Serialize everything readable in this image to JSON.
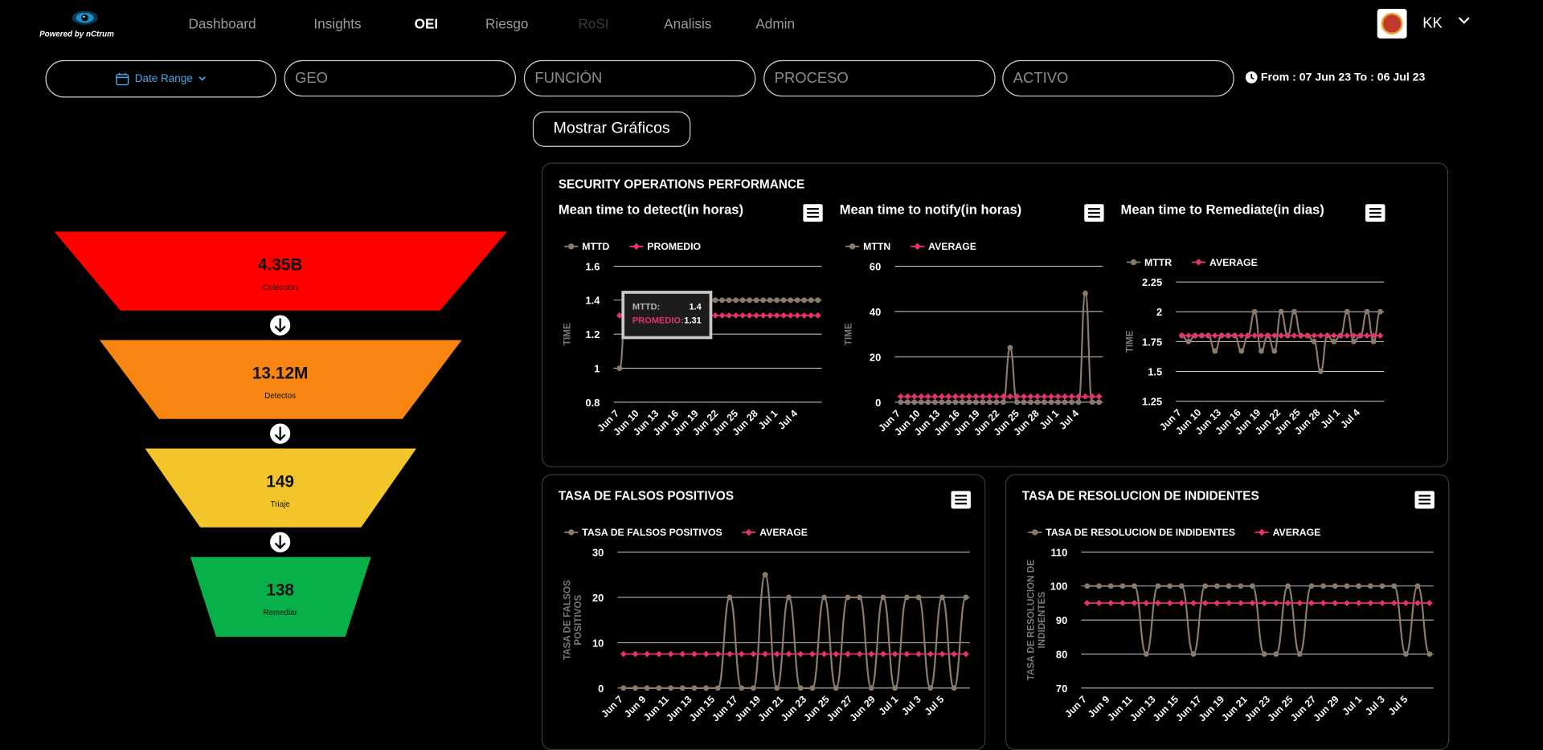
{
  "branding": {
    "powered_by": "Powered by  nCtrum"
  },
  "nav": {
    "items": [
      {
        "label": "Dashboard",
        "state": "normal"
      },
      {
        "label": "Insights",
        "state": "normal"
      },
      {
        "label": "OEI",
        "state": "active"
      },
      {
        "label": "Riesgo",
        "state": "normal"
      },
      {
        "label": "RoSI",
        "state": "disabled"
      },
      {
        "label": "Analisis",
        "state": "normal"
      },
      {
        "label": "Admin",
        "state": "normal"
      }
    ]
  },
  "user": {
    "initials": "KK"
  },
  "filters": {
    "date_range_label": "Date Range",
    "geo_placeholder": "GEO",
    "funcion_placeholder": "FUNCIÓN",
    "proceso_placeholder": "PROCESO",
    "activo_placeholder": "ACTIVO",
    "from_to": "From : 07 Jun 23 To : 06 Jul 23"
  },
  "mostrar_graficos": "Mostrar Gráficos",
  "funnel": [
    {
      "value": "4.35B",
      "label": "Coleccion",
      "color": "#fe0000"
    },
    {
      "value": "13.12M",
      "label": "Detectos",
      "color": "#f78511"
    },
    {
      "value": "149",
      "label": "Triaje",
      "color": "#f2c62a"
    },
    {
      "value": "138",
      "label": "Remediar",
      "color": "#09b04a"
    }
  ],
  "panels": {
    "sec_ops_title": "SECURITY OPERATIONS PERFORMANCE",
    "falsos_title": "TASA DE FALSOS POSITIVOS",
    "resolucion_title": "TASA DE RESOLUCION DE INDIDENTES"
  },
  "colors": {
    "series": "#8a7a6b",
    "average": "#e5336a"
  },
  "chart_data": [
    {
      "type": "line",
      "title": "Mean time to detect(in horas)",
      "ylabel": "TIME",
      "ylim": [
        0.8,
        1.6
      ],
      "yticks": [
        "0.8",
        "1",
        "1.2",
        "1.4",
        "1.6"
      ],
      "tick_values": [
        0.8,
        1,
        1.2,
        1.4,
        1.6
      ],
      "x_labels": [
        "Jun 7",
        "Jun 10",
        "Jun 13",
        "Jun 16",
        "Jun 19",
        "Jun 22",
        "Jun 25",
        "Jun 28",
        "Jul 1",
        "Jul 4"
      ],
      "series": [
        {
          "name": "MTTD",
          "values": [
            1.0,
            1.4,
            1.4,
            1.4,
            1.4,
            1.4,
            1.4,
            1.4,
            1.4,
            1.4,
            1.4,
            1.4,
            1.4,
            1.4,
            1.4,
            1.4,
            1.4,
            1.4,
            1.4,
            1.4,
            1.4,
            1.4,
            1.4,
            1.4,
            1.4,
            1.4,
            1.4,
            1.4,
            1.4,
            1.4
          ]
        },
        {
          "name": "PROMEDIO",
          "values": [
            1.31,
            1.31,
            1.31,
            1.31,
            1.31,
            1.31,
            1.31,
            1.31,
            1.31,
            1.31,
            1.31,
            1.31,
            1.31,
            1.31,
            1.31,
            1.31,
            1.31,
            1.31,
            1.31,
            1.31,
            1.31,
            1.31,
            1.31,
            1.31,
            1.31,
            1.31,
            1.31,
            1.31,
            1.31,
            1.31
          ]
        }
      ],
      "tooltip": {
        "label1": "MTTD:",
        "value1": "1.4",
        "label2": "PROMEDIO:",
        "value2": "1.31"
      }
    },
    {
      "type": "line",
      "title": "Mean time to notify(in horas)",
      "ylabel": "TIME",
      "ylim": [
        0,
        60
      ],
      "yticks": [
        "0",
        "20",
        "40",
        "60"
      ],
      "tick_values": [
        0,
        20,
        40,
        60
      ],
      "x_labels": [
        "Jun 7",
        "Jun 10",
        "Jun 13",
        "Jun 16",
        "Jun 19",
        "Jun 22",
        "Jun 25",
        "Jun 28",
        "Jul 1",
        "Jul 4"
      ],
      "series": [
        {
          "name": "MTTN",
          "values": [
            0,
            0,
            0,
            0,
            0,
            0,
            0,
            0,
            0,
            0,
            0,
            0,
            0,
            0,
            0,
            0,
            24,
            0,
            0,
            0,
            0,
            0,
            0,
            0,
            0,
            0,
            0,
            48,
            0,
            0
          ]
        },
        {
          "name": "AVERAGE",
          "values": [
            2.5,
            2.5,
            2.5,
            2.5,
            2.5,
            2.5,
            2.5,
            2.5,
            2.5,
            2.5,
            2.5,
            2.5,
            2.5,
            2.5,
            2.5,
            2.5,
            2.5,
            2.5,
            2.5,
            2.5,
            2.5,
            2.5,
            2.5,
            2.5,
            2.5,
            2.5,
            2.5,
            2.5,
            2.5,
            2.5
          ]
        }
      ]
    },
    {
      "type": "line",
      "title": "Mean time to Remediate(in dias)",
      "ylabel": "TIME",
      "ylim": [
        1.25,
        2.25
      ],
      "yticks": [
        "1.25",
        "1.5",
        "1.75",
        "2",
        "2.25"
      ],
      "tick_values": [
        1.25,
        1.5,
        1.75,
        2,
        2.25
      ],
      "x_labels": [
        "Jun 7",
        "Jun 10",
        "Jun 13",
        "Jun 16",
        "Jun 19",
        "Jun 22",
        "Jun 25",
        "Jun 28",
        "Jul 1",
        "Jul 4"
      ],
      "series": [
        {
          "name": "MTTR",
          "values": [
            1.8,
            1.75,
            1.8,
            1.8,
            1.8,
            1.67,
            1.8,
            1.8,
            1.8,
            1.67,
            1.8,
            2.0,
            1.67,
            1.8,
            1.67,
            2.0,
            1.8,
            2.0,
            1.8,
            1.8,
            1.75,
            1.5,
            1.8,
            1.75,
            1.8,
            2.0,
            1.75,
            1.8,
            2.0,
            1.75,
            2.0
          ]
        },
        {
          "name": "AVERAGE",
          "values": [
            1.8,
            1.8,
            1.8,
            1.8,
            1.8,
            1.8,
            1.8,
            1.8,
            1.8,
            1.8,
            1.8,
            1.8,
            1.8,
            1.8,
            1.8,
            1.8,
            1.8,
            1.8,
            1.8,
            1.8,
            1.8,
            1.8,
            1.8,
            1.8,
            1.8,
            1.8,
            1.8,
            1.8,
            1.8,
            1.8,
            1.8
          ]
        }
      ]
    },
    {
      "type": "line",
      "title": "TASA DE FALSOS POSITIVOS",
      "ylabel": "TASA DE FALSOS POSITIVOS",
      "ylim": [
        0,
        30
      ],
      "yticks": [
        "0",
        "10",
        "20",
        "30"
      ],
      "tick_values": [
        0,
        10,
        20,
        30
      ],
      "x_labels": [
        "Jun 7",
        "Jun 9",
        "Jun 11",
        "Jun 13",
        "Jun 15",
        "Jun 17",
        "Jun 19",
        "Jun 21",
        "Jun 23",
        "Jun 25",
        "Jun 27",
        "Jun 29",
        "Jul 1",
        "Jul 3",
        "Jul 5"
      ],
      "series": [
        {
          "name": "TASA DE FALSOS POSITIVOS",
          "values": [
            0,
            0,
            0,
            0,
            0,
            0,
            0,
            0,
            0,
            20,
            0,
            0,
            25,
            0,
            20,
            0,
            0,
            20,
            0,
            20,
            20,
            0,
            20,
            0,
            20,
            20,
            0,
            20,
            0,
            20
          ]
        },
        {
          "name": "AVERAGE",
          "values": [
            7.5,
            7.5,
            7.5,
            7.5,
            7.5,
            7.5,
            7.5,
            7.5,
            7.5,
            7.5,
            7.5,
            7.5,
            7.5,
            7.5,
            7.5,
            7.5,
            7.5,
            7.5,
            7.5,
            7.5,
            7.5,
            7.5,
            7.5,
            7.5,
            7.5,
            7.5,
            7.5,
            7.5,
            7.5,
            7.5
          ]
        }
      ]
    },
    {
      "type": "line",
      "title": "TASA DE RESOLUCION DE INDIDENTES",
      "ylabel": "TASA DE RESOLUCION DE INDIDENTES",
      "ylim": [
        70,
        110
      ],
      "yticks": [
        "70",
        "80",
        "90",
        "100",
        "110"
      ],
      "tick_values": [
        70,
        80,
        90,
        100,
        110
      ],
      "x_labels": [
        "Jun 7",
        "Jun 9",
        "Jun 11",
        "Jun 13",
        "Jun 15",
        "Jun 17",
        "Jun 19",
        "Jun 21",
        "Jun 23",
        "Jun 25",
        "Jun 27",
        "Jun 29",
        "Jul 1",
        "Jul 3",
        "Jul 5"
      ],
      "series": [
        {
          "name": "TASA DE RESOLUCION DE INDIDENTES",
          "values": [
            100,
            100,
            100,
            100,
            100,
            80,
            100,
            100,
            100,
            80,
            100,
            100,
            100,
            100,
            100,
            80,
            80,
            100,
            80,
            100,
            100,
            100,
            100,
            100,
            100,
            100,
            100,
            80,
            100,
            80
          ]
        },
        {
          "name": "AVERAGE",
          "values": [
            95,
            95,
            95,
            95,
            95,
            95,
            95,
            95,
            95,
            95,
            95,
            95,
            95,
            95,
            95,
            95,
            95,
            95,
            95,
            95,
            95,
            95,
            95,
            95,
            95,
            95,
            95,
            95,
            95,
            95
          ]
        }
      ]
    }
  ]
}
